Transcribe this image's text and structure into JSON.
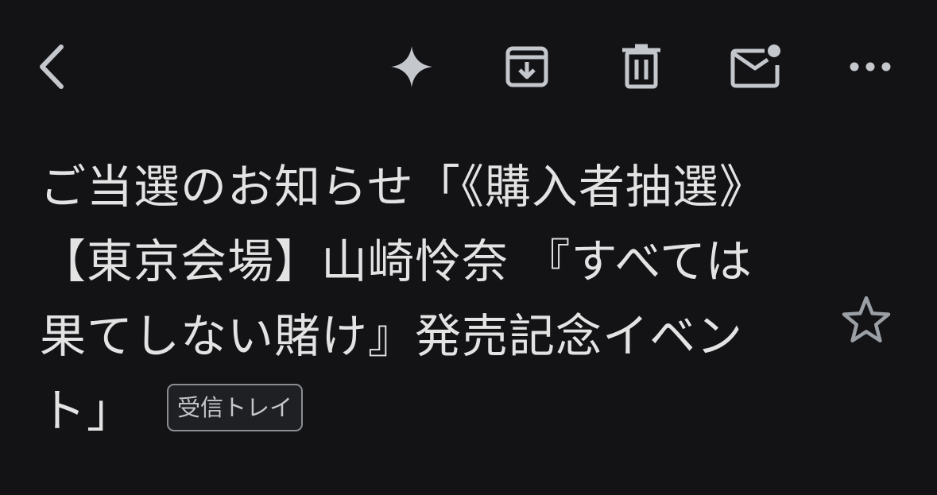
{
  "toolbar": {
    "back_icon": "chevron-left-icon",
    "gemini_icon": "sparkle-icon",
    "archive_icon": "archive-icon",
    "delete_icon": "trash-icon",
    "unread_icon": "mark-unread-icon",
    "more_icon": "more-horizontal-icon"
  },
  "message": {
    "subject": "ご当選のお知らせ「《購入者抽選》【東京会場】山崎怜奈 『すべては果てしない賭け』発売記念イベント」",
    "label": "受信トレイ",
    "starred": false,
    "star_icon": "star-outline-icon"
  },
  "colors": {
    "background": "#131316",
    "text": "#e3e3e3",
    "icon": "#c4c7cc",
    "chip_border": "#8a8d93"
  }
}
